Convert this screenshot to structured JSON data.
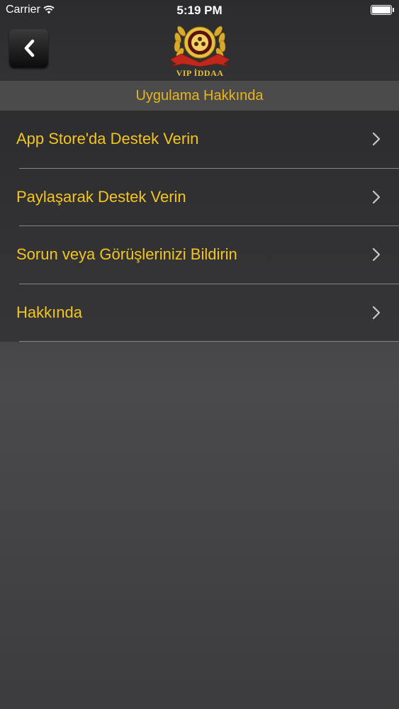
{
  "status_bar": {
    "carrier": "Carrier",
    "time": "5:19 PM",
    "battery_level": 1.0
  },
  "nav": {
    "back_icon": "chevron-left-icon",
    "logo_text": "VIP İDDAA"
  },
  "section": {
    "title": "Uygulama Hakkında"
  },
  "menu": {
    "items": [
      {
        "label": "App Store'da Destek Verin",
        "icon": "chevron-right-icon"
      },
      {
        "label": "Paylaşarak Destek Verin",
        "icon": "chevron-right-icon"
      },
      {
        "label": "Sorun veya Görüşlerinizi Bildirin",
        "icon": "chevron-right-icon"
      },
      {
        "label": "Hakkında",
        "icon": "chevron-right-icon"
      }
    ]
  },
  "colors": {
    "accent_text": "#f3c51e",
    "section_title": "#e9b51d",
    "logo_gold": "#e7bf3c",
    "logo_red": "#c0281c"
  }
}
